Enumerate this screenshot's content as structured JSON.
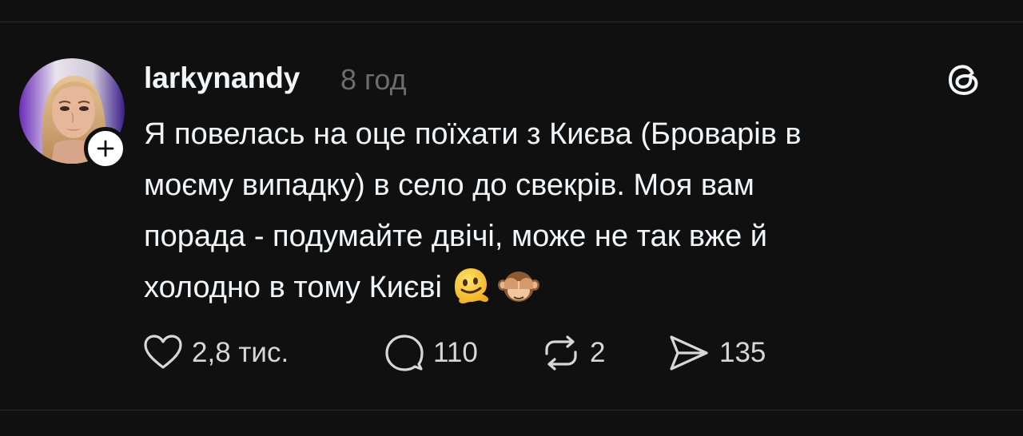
{
  "post": {
    "username": "larkynandy",
    "timestamp": "8 год",
    "text_lines": [
      "Я повелась на оце поїхати з Києва (Броварів в",
      "моєму випадку) в село до свекрів. Моя вам",
      "порада - подумайте двічі, може не так вже й",
      "холодно в тому Києві"
    ],
    "emojis": [
      "melting-face",
      "see-no-evil-monkey"
    ]
  },
  "actions": {
    "likes": "2,8 тис.",
    "comments": "110",
    "reposts": "2",
    "shares": "135"
  },
  "colors": {
    "background": "#101010",
    "text": "#f3f5f7",
    "muted": "#6c6c6c",
    "divider": "#2a2a2a"
  },
  "icons": {
    "follow": "plus-icon",
    "app": "threads-logo-icon",
    "like": "heart-icon",
    "comment": "comment-bubble-icon",
    "repost": "repost-icon",
    "share": "send-icon"
  }
}
